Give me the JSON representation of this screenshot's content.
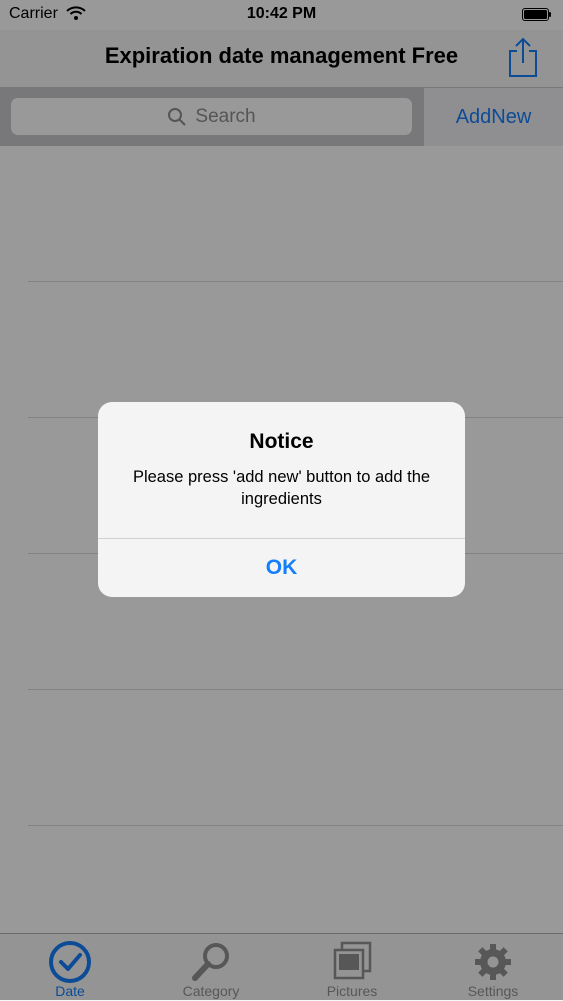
{
  "status_bar": {
    "carrier": "Carrier",
    "time": "10:42 PM"
  },
  "nav": {
    "title": "Expiration date management Free",
    "share_icon": "share-icon"
  },
  "search": {
    "placeholder": "Search",
    "add_new": "AddNew"
  },
  "tabs": [
    {
      "label": "Date",
      "icon": "clock-icon",
      "active": true
    },
    {
      "label": "Category",
      "icon": "magnifier-icon",
      "active": false
    },
    {
      "label": "Pictures",
      "icon": "pictures-icon",
      "active": false
    },
    {
      "label": "Settings",
      "icon": "gear-icon",
      "active": false
    }
  ],
  "alert": {
    "title": "Notice",
    "message": "Please press 'add new' button to add the ingredients",
    "ok": "OK"
  },
  "colors": {
    "accent": "#157efb",
    "overlay": "rgba(0,0,0,0.40)"
  }
}
